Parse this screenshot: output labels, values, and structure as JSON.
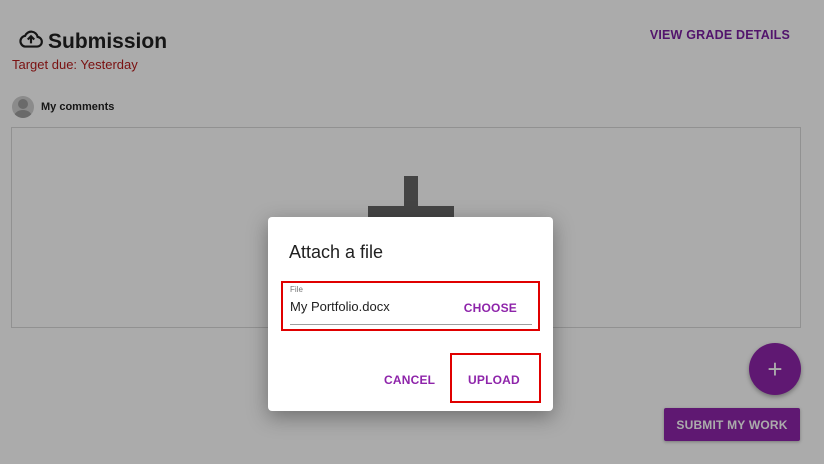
{
  "page": {
    "title": "Submission",
    "view_grade_label": "VIEW GRADE DETAILS",
    "due_text": "Target due: Yesterday",
    "comments_label": "My comments",
    "submit_label": "SUBMIT MY WORK",
    "fab_label": "+"
  },
  "dialog": {
    "title": "Attach a file",
    "file_label": "File",
    "file_value": "My Portfolio.docx",
    "choose_label": "CHOOSE",
    "cancel_label": "CANCEL",
    "upload_label": "UPLOAD"
  },
  "icons": {
    "title_icon": "cloud-upload-icon",
    "avatar": "user-avatar-icon",
    "dropzone_icon": "plus-icon"
  },
  "colors": {
    "accent": "#8e24aa",
    "due_text": "#b71c1c",
    "highlight": "#e00000"
  }
}
